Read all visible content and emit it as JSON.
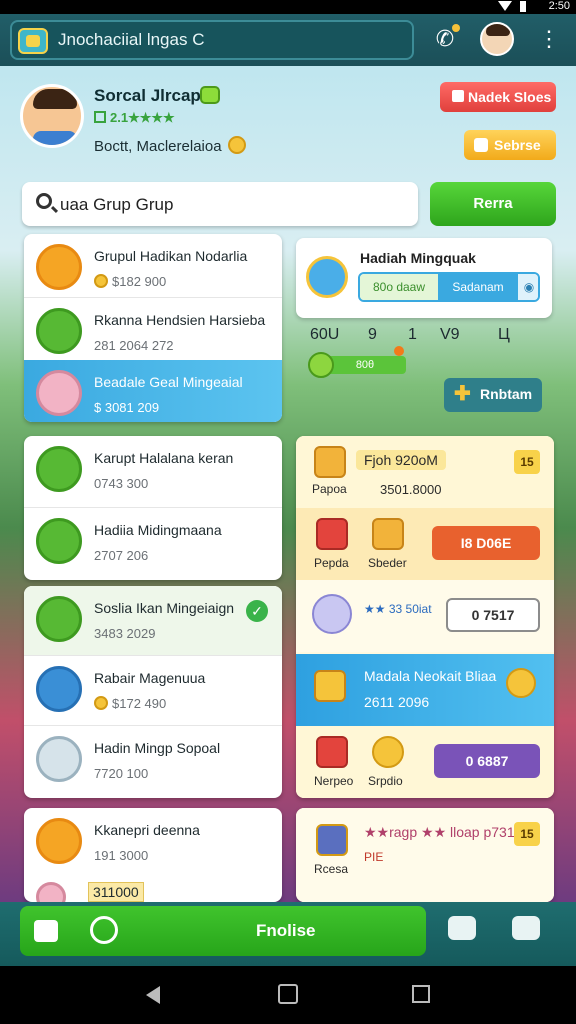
{
  "status": {
    "time": "2:50"
  },
  "topbar": {
    "search_text": "Jnochaciial lngas С"
  },
  "profile": {
    "name": "Sorcal Jlrcap",
    "stars": "2.1★★★★",
    "subtitle": "Boctt, Maclerelaioa",
    "red_button": "Nadek Sloes",
    "yellow_button": "Sebrse"
  },
  "search": {
    "value": "uaa Grup Grup",
    "button": "Rerra"
  },
  "left_list_1": [
    {
      "title": "Grupul Hadikan Nodarlia",
      "sub": "$182 900",
      "icon": "crown-coin-icon"
    },
    {
      "title": "Rkanna Hendsien Harsieba",
      "sub": "281 2064 272",
      "icon": "bowl-icon"
    },
    {
      "title": "Beadale Geal Mingeaial",
      "sub": "$ 3081 209",
      "icon": "candy-icon"
    }
  ],
  "left_list_2": [
    {
      "title": "Karupt Halalana keran",
      "sub": "0743 300",
      "icon": "avatar-icon"
    },
    {
      "title": "Hadiia Midingmaana",
      "sub": "2707 206",
      "icon": "food-icon"
    }
  ],
  "left_list_3": [
    {
      "title": "Soslia Ikan Mingeiaign",
      "sub": "3483 2029",
      "icon": "fish-icon"
    },
    {
      "title": "Rabair Magenuua",
      "sub": "$172 490",
      "icon": "ribbon-icon"
    },
    {
      "title": "Hadin Mingp Sopoal",
      "sub": "7720 100",
      "icon": "box-icon"
    }
  ],
  "left_list_4": [
    {
      "title": "Kkanepri deenna",
      "sub": "191 3000",
      "icon": "puzzle-icon"
    },
    {
      "title": "",
      "sub": "311000",
      "icon": "snail-icon"
    }
  ],
  "weekly": {
    "title": "Hadiah Mingquak",
    "tab_a": "80o daaw",
    "tab_b": "Sadanam",
    "tab_b_icon": "◉",
    "numbers": [
      "60U",
      "9",
      "1",
      "V9",
      "Ц"
    ],
    "progress_label": "80θ",
    "button": "Rnbtam"
  },
  "shop": {
    "row1": {
      "title": "Fjoh 920oM",
      "badge": "15",
      "item": "Papoa",
      "sub": "3501.8000"
    },
    "row2": {
      "item_a": "Pepda",
      "item_b": "Sbeder",
      "button": "I8 D06E"
    },
    "row3": {
      "stars": "★★ 33 50іаt",
      "button": "0 7517"
    },
    "row4": {
      "title": "Madala Neokait Bliaa",
      "sub": "2611 2096"
    },
    "row5": {
      "item_a": "Nerpeo",
      "item_b": "Srpdio",
      "button": "0 6887"
    },
    "row6": {
      "title": "★★ragp ★★ lloap p731",
      "badge": "15",
      "item": "Rcesa",
      "sub": "PIE"
    }
  },
  "bottom": {
    "main_label": "Fnolise"
  },
  "colors": {
    "accent_green": "#2ea51c",
    "accent_blue": "#3aa9e0",
    "accent_red": "#e0403c",
    "teal": "#1b4f58"
  }
}
